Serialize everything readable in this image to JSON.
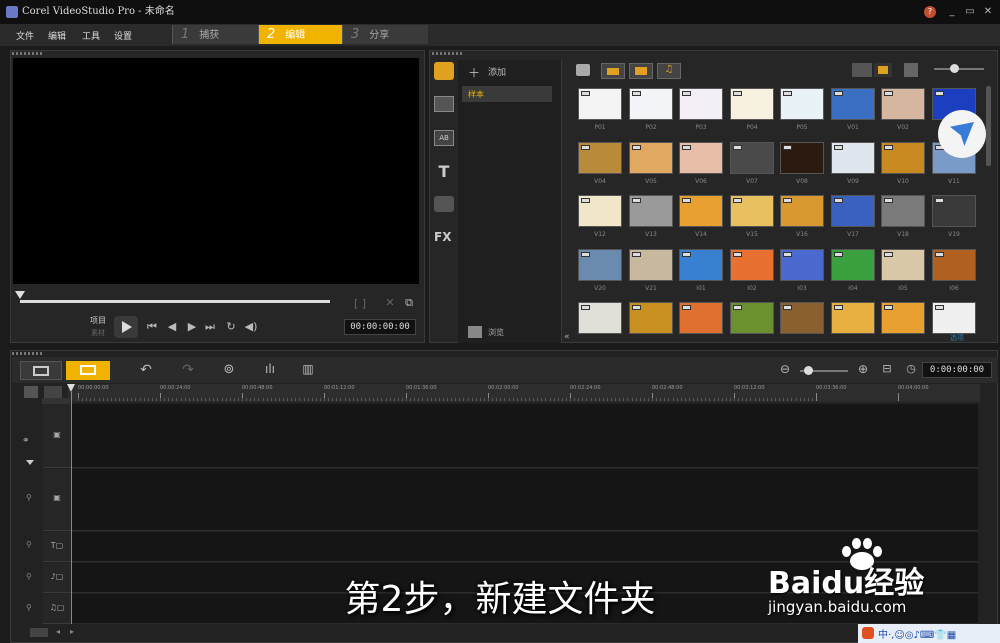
{
  "titlebar": {
    "title": "Corel VideoStudio Pro - 未命名",
    "min": "_",
    "restore": "▭",
    "close": "✕"
  },
  "menu": [
    "文件",
    "编辑",
    "工具",
    "设置"
  ],
  "steps": [
    {
      "num": "1",
      "label": "捕获",
      "active": false
    },
    {
      "num": "2",
      "label": "编辑",
      "active": true
    },
    {
      "num": "3",
      "label": "分享",
      "active": false
    }
  ],
  "preview": {
    "mode_project": "项目",
    "mode_clip": "素材",
    "timecode": "00:00:00:00"
  },
  "library": {
    "add_label": "添加",
    "folder_label": "样本",
    "browse_label": "浏览",
    "thumbs": [
      {
        "label": "P01",
        "color": "#f4f4f4"
      },
      {
        "label": "P02",
        "color": "#f2f4f8"
      },
      {
        "label": "P03",
        "color": "#f4eef6"
      },
      {
        "label": "P04",
        "color": "#f7f1e0"
      },
      {
        "label": "P05",
        "color": "#e9f2f6"
      },
      {
        "label": "V01",
        "color": "#3a6fc4"
      },
      {
        "label": "V02",
        "color": "#d7b6a0"
      },
      {
        "label": "",
        "color": "#1c3fc0"
      },
      {
        "label": "V04",
        "color": "#b88a3a"
      },
      {
        "label": "V05",
        "color": "#e0a860"
      },
      {
        "label": "V06",
        "color": "#e8bda8"
      },
      {
        "label": "V07",
        "color": "#4a4a4a"
      },
      {
        "label": "V08",
        "color": "#2a1a10"
      },
      {
        "label": "V09",
        "color": "#dfe6ee"
      },
      {
        "label": "V10",
        "color": "#c88a20"
      },
      {
        "label": "V11",
        "color": "#7a9ac8"
      },
      {
        "label": "V12",
        "color": "#f2e6c8"
      },
      {
        "label": "V13",
        "color": "#9a9a9a"
      },
      {
        "label": "V14",
        "color": "#e8a030"
      },
      {
        "label": "V15",
        "color": "#e8c060"
      },
      {
        "label": "V16",
        "color": "#d89a30"
      },
      {
        "label": "V17",
        "color": "#3a60c0"
      },
      {
        "label": "V18",
        "color": "#7a7a7a"
      },
      {
        "label": "V19",
        "color": "#3a3a3a"
      },
      {
        "label": "V20",
        "color": "#6a8ab0"
      },
      {
        "label": "V21",
        "color": "#c8b8a0"
      },
      {
        "label": "I01",
        "color": "#3a80d0"
      },
      {
        "label": "I02",
        "color": "#e87030"
      },
      {
        "label": "I03",
        "color": "#4a6ad0"
      },
      {
        "label": "I04",
        "color": "#3aa040"
      },
      {
        "label": "I05",
        "color": "#d8c8a8"
      },
      {
        "label": "I06",
        "color": "#b06020"
      },
      {
        "label": "",
        "color": "#e0e0d8"
      },
      {
        "label": "",
        "color": "#c89020"
      },
      {
        "label": "",
        "color": "#e07030"
      },
      {
        "label": "",
        "color": "#6a9030"
      },
      {
        "label": "",
        "color": "#8a6030"
      },
      {
        "label": "",
        "color": "#e8b040"
      },
      {
        "label": "",
        "color": "#e8a030"
      },
      {
        "label": "",
        "color": "#f0f0f0"
      }
    ],
    "options_label": "选项"
  },
  "timeline": {
    "timecode": "0:00:00:00",
    "ruler": [
      "00:00:00:00",
      "00:00:24:00",
      "00:00:48:00",
      "00:01:12:00",
      "00:01:36:00",
      "00:02:00:00",
      "00:02:24:00",
      "00:02:48:00",
      "00:03:12:00",
      "00:03:36:00",
      "00:04:00:00"
    ]
  },
  "subtitle": "第2步，新建文件夹",
  "watermark": {
    "brand": "Baidu经验",
    "url": "jingyan.baidu.com"
  },
  "colors": {
    "accent": "#f0b400",
    "background": "#1b1b1b"
  }
}
